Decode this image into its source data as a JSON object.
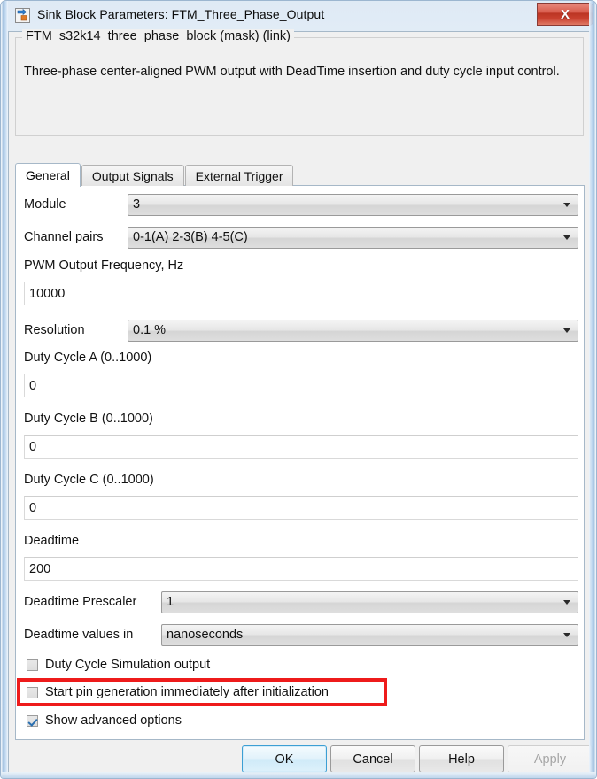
{
  "window": {
    "title": "Sink Block Parameters: FTM_Three_Phase_Output",
    "icon": "simulink-block-icon",
    "close_label": "X"
  },
  "mask": {
    "group_title": "FTM_s32k14_three_phase_block (mask) (link)",
    "description": "Three-phase center-aligned PWM output with DeadTime insertion and duty cycle input control."
  },
  "tabs": [
    {
      "label": "General",
      "active": true
    },
    {
      "label": "Output Signals",
      "active": false
    },
    {
      "label": "External Trigger",
      "active": false
    }
  ],
  "form": {
    "module": {
      "label": "Module",
      "value": "3"
    },
    "channel_pairs": {
      "label": "Channel pairs",
      "value": "0-1(A) 2-3(B) 4-5(C)"
    },
    "pwm_frequency": {
      "label": "PWM Output Frequency, Hz",
      "value": "10000"
    },
    "resolution": {
      "label": "Resolution",
      "value": "0.1 %"
    },
    "duty_cycle_a": {
      "label": "Duty Cycle A (0..1000)",
      "value": "0"
    },
    "duty_cycle_b": {
      "label": "Duty Cycle B (0..1000)",
      "value": "0"
    },
    "duty_cycle_c": {
      "label": "Duty Cycle C (0..1000)",
      "value": "0"
    },
    "deadtime": {
      "label": "Deadtime",
      "value": "200"
    },
    "deadtime_prescaler": {
      "label": "Deadtime Prescaler",
      "value": "1"
    },
    "deadtime_values_in": {
      "label": "Deadtime values in",
      "value": "nanoseconds"
    }
  },
  "checkboxes": [
    {
      "label": "Duty Cycle Simulation output",
      "checked": false
    },
    {
      "label": "Start pin generation immediately after initialization",
      "checked": false
    },
    {
      "label": "Show advanced options",
      "checked": true
    }
  ],
  "annotation": {
    "color": "#ee1b1b",
    "target": "Start pin generation immediately after initialization"
  },
  "buttons": {
    "ok": "OK",
    "cancel": "Cancel",
    "help": "Help",
    "apply": "Apply"
  }
}
